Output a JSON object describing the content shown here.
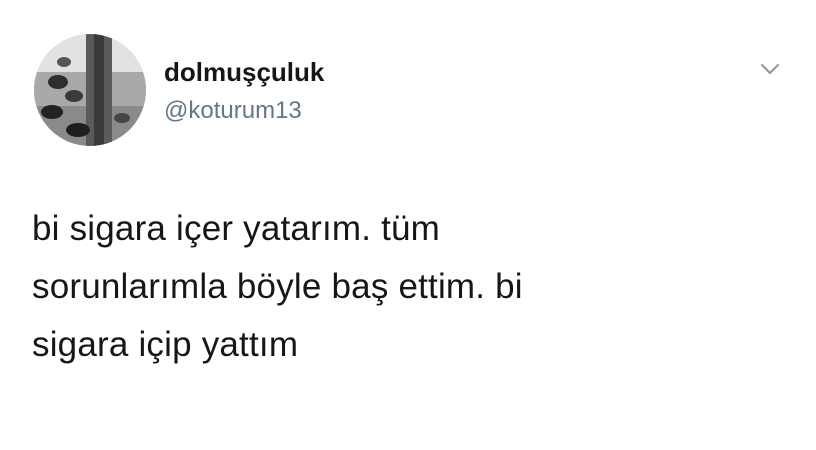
{
  "tweet": {
    "author": {
      "display_name": "dolmuşçuluk",
      "handle": "@koturum13",
      "avatar": "avatar-photo"
    },
    "menu_icon": "chevron-down-icon",
    "text_lines": [
      "bi sigara içer yatarım. tüm",
      "sorunlarımla böyle baş ettim. bi",
      "sigara içip yattım"
    ]
  },
  "colors": {
    "background": "#ffffff",
    "text": "#14171a",
    "secondary_text": "#657786",
    "chevron": "#8899a6"
  }
}
